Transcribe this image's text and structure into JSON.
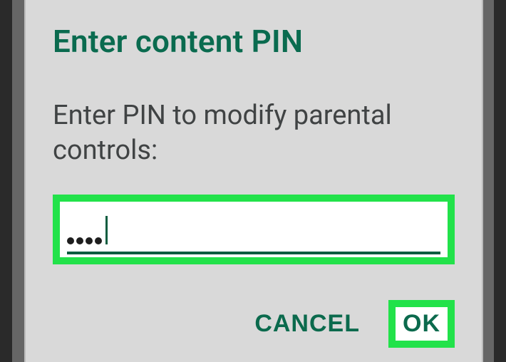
{
  "dialog": {
    "title": "Enter content PIN",
    "message": "Enter PIN to modify parental controls:",
    "pin_masked": "••••",
    "pin_length_entered": 4
  },
  "actions": {
    "cancel_label": "CANCEL",
    "ok_label": "OK"
  },
  "colors": {
    "accent": "#0b6a4d",
    "highlight": "#22e24a",
    "dialog_bg": "#d9d9d9"
  }
}
